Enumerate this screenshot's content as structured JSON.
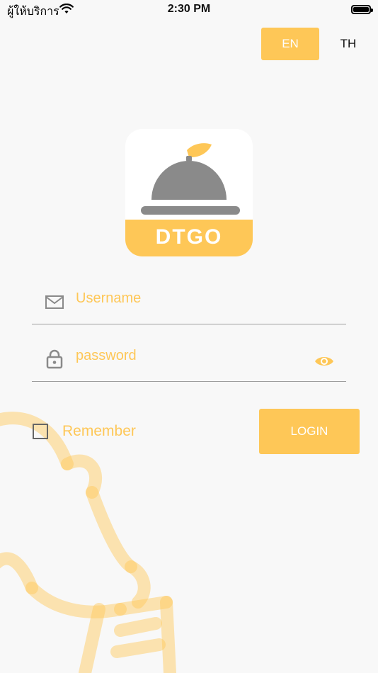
{
  "status_bar": {
    "carrier": "ผู้ให้บริการ",
    "time": "2:30 PM"
  },
  "language": {
    "en_label": "EN",
    "th_label": "TH",
    "selected": "EN"
  },
  "logo": {
    "text": "DTGO"
  },
  "form": {
    "username_placeholder": "Username",
    "password_placeholder": "password",
    "remember_label": "Remember",
    "remember_checked": false,
    "login_label": "LOGIN"
  },
  "colors": {
    "accent": "#FEC757",
    "icon_gray": "#8a8a8a",
    "background": "#f8f8f8"
  },
  "icons": {
    "status": [
      "wifi-icon",
      "battery-icon"
    ],
    "username": "mail-icon",
    "password": "lock-icon",
    "visibility": "eye-icon"
  }
}
